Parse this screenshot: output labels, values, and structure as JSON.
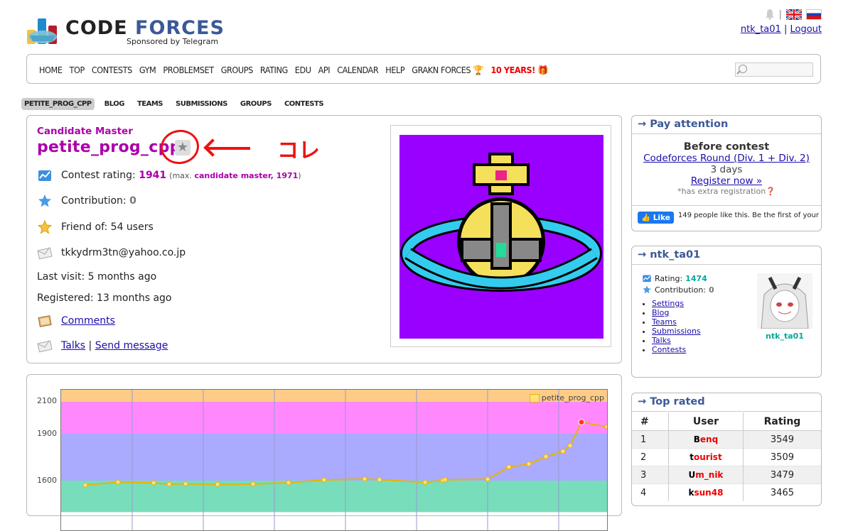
{
  "header": {
    "logo_code": "CODE",
    "logo_forces": "FORCES",
    "sponsor": "Sponsored by Telegram",
    "user_link": "ntk_ta01",
    "separator": "|",
    "logout": "Logout"
  },
  "menu": [
    "HOME",
    "TOP",
    "CONTESTS",
    "GYM",
    "PROBLEMSET",
    "GROUPS",
    "RATING",
    "EDU",
    "API",
    "CALENDAR",
    "HELP",
    "GRAKN FORCES 🏆",
    "10 YEARS! 🎁"
  ],
  "submenu": [
    "PETITE_PROG_CPP",
    "BLOG",
    "TEAMS",
    "SUBMISSIONS",
    "GROUPS",
    "CONTESTS"
  ],
  "profile": {
    "rank": "Candidate Master",
    "handle": "petite_prog_cpp",
    "annotation": "コレ",
    "rating_label": "Contest rating:",
    "rating_value": "1941",
    "max_prefix": "(max.",
    "max_rank": "candidate master, 1971",
    "max_suffix": ")",
    "contrib_label": "Contribution:",
    "contrib_value": "0",
    "friends": "Friend of: 54 users",
    "email": "tkkydrm3tn@yahoo.co.jp",
    "last_visit": "Last visit: 5 months ago",
    "registered": "Registered: 13 months ago",
    "comments": "Comments",
    "talks": "Talks",
    "send_message": "Send message"
  },
  "chart_data": {
    "type": "line",
    "title": "",
    "series": [
      {
        "name": "petite_prog_cpp",
        "values": [
          1572,
          1590,
          1586,
          1577,
          1580,
          1576,
          1578,
          1587,
          1604,
          1610,
          1606,
          1588,
          1601,
          1605,
          1609,
          1686,
          1706,
          1752,
          1786,
          1822,
          1971,
          1941
        ]
      }
    ],
    "ylim": [
      1550,
      2100
    ],
    "yticks": [
      2100,
      1900,
      1600
    ],
    "bands": [
      {
        "from": 2100,
        "to": 2200,
        "color": "#ffcc88"
      },
      {
        "from": 1900,
        "to": 2100,
        "color": "#ff88ff"
      },
      {
        "from": 1600,
        "to": 1900,
        "color": "#aaaaff"
      },
      {
        "from": 1400,
        "to": 1600,
        "color": "#77ddbb"
      }
    ],
    "legend": "top-right"
  },
  "pay_attention": {
    "title": "→ Pay attention",
    "before": "Before contest",
    "round": "Codeforces Round (Div. 1 + Div. 2)",
    "days": "3 days",
    "register": "Register now »",
    "extra": "*has extra registration",
    "like_btn": "Like",
    "like_text": "149 people like this. Be the first of your friends."
  },
  "user_box": {
    "title": "→ ntk_ta01",
    "rating_label": "Rating:",
    "rating_value": "1474",
    "contrib_label": "Contribution:",
    "contrib_value": "0",
    "links": [
      "Settings",
      "Blog",
      "Teams",
      "Submissions",
      "Talks",
      "Contests"
    ],
    "avatar_name": "ntk_ta01"
  },
  "top_rated": {
    "title": "→ Top rated",
    "headers": [
      "#",
      "User",
      "Rating"
    ],
    "rows": [
      {
        "rank": "1",
        "first": "B",
        "rest": "enq",
        "rating": "3549"
      },
      {
        "rank": "2",
        "first": "t",
        "rest": "ourist",
        "rating": "3509"
      },
      {
        "rank": "3",
        "first": "U",
        "rest": "m_nik",
        "rating": "3479"
      },
      {
        "rank": "4",
        "first": "k",
        "rest": "sun48",
        "rating": "3465"
      }
    ]
  },
  "colors": {
    "candidate_master": "#aa00aa",
    "link": "#1a0dab",
    "specialist": "#03a89e",
    "legendary": "#ee0000"
  }
}
